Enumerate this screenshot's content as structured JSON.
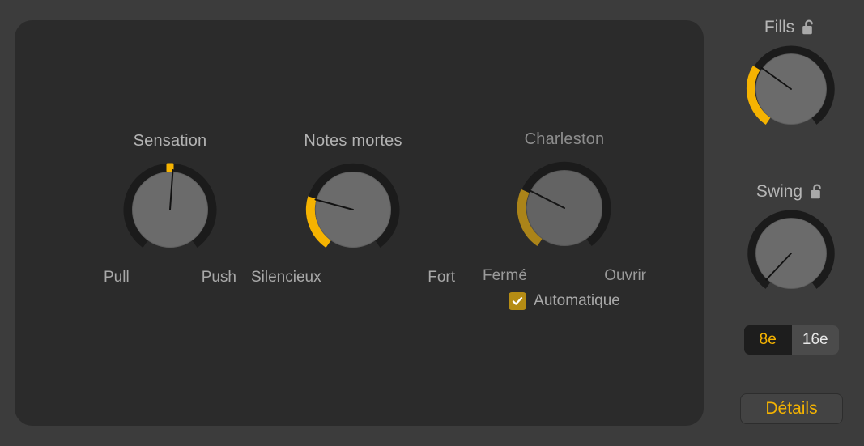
{
  "colors": {
    "page_background": "#3c3c3c",
    "panel_background": "#2b2b2b",
    "accent_yellow": "#f5b301",
    "accent_yellow_dim": "#b58c14",
    "knob_face": "#6b6b6b",
    "knob_track": "#1e1e1e",
    "label_gray": "#a8a8a8"
  },
  "main_panel": {
    "knobs": [
      {
        "id": "sensation",
        "title": "Sensation",
        "min_label": "Pull",
        "max_label": "Push",
        "value_angle": 184,
        "center_marker": true,
        "arc_from": 184,
        "arc_to": 184,
        "disabled": false
      },
      {
        "id": "notes-mortes",
        "title": "Notes mortes",
        "min_label": "Silencieux",
        "max_label": "Fort",
        "value_angle": 103,
        "center_marker": false,
        "arc_from": 30,
        "arc_to": 103,
        "disabled": false
      },
      {
        "id": "charleston",
        "title": "Charleston",
        "min_label": "Fermé",
        "max_label": "Ouvrir",
        "value_angle": 113,
        "center_marker": false,
        "arc_from": 30,
        "arc_to": 113,
        "disabled": true
      }
    ],
    "checkbox": {
      "label": "Automatique",
      "checked": true,
      "checkmark_icon": "check-icon"
    }
  },
  "rail": {
    "fills": {
      "title": "Fills",
      "lock_icon": "unlocked-padlock-icon",
      "locked": false,
      "value_angle": 122,
      "arc_from": 30,
      "arc_to": 122
    },
    "swing": {
      "title": "Swing",
      "lock_icon": "unlocked-padlock-icon",
      "locked": false,
      "value_angle": 30,
      "arc_from": 30,
      "arc_to": 30
    },
    "segmented": {
      "options": [
        {
          "label": "8e",
          "selected": true
        },
        {
          "label": "16e",
          "selected": false
        }
      ]
    },
    "details_button": {
      "label": "Détails"
    }
  }
}
